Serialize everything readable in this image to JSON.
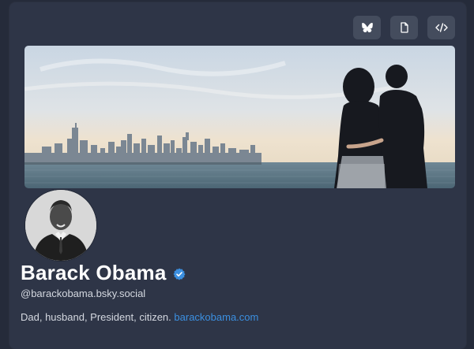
{
  "toolbar": {
    "buttons": [
      {
        "icon": "butterfly-icon",
        "action": "bluesky"
      },
      {
        "icon": "document-icon",
        "action": "document"
      },
      {
        "icon": "code-icon",
        "action": "embed-code"
      }
    ]
  },
  "profile": {
    "display_name": "Barack Obama",
    "verified": true,
    "handle": "@barackobama.bsky.social",
    "bio_text": "Dad, husband, President, citizen.",
    "bio_link": "barackobama.com"
  },
  "colors": {
    "page_background": "#252b3a",
    "card_background": "#2e3547",
    "button_background": "#444c5d",
    "link": "#3b8fe0",
    "verified_badge": "#3b8fe0",
    "name_text": "#ffffff",
    "body_text": "#d4d8e0"
  }
}
